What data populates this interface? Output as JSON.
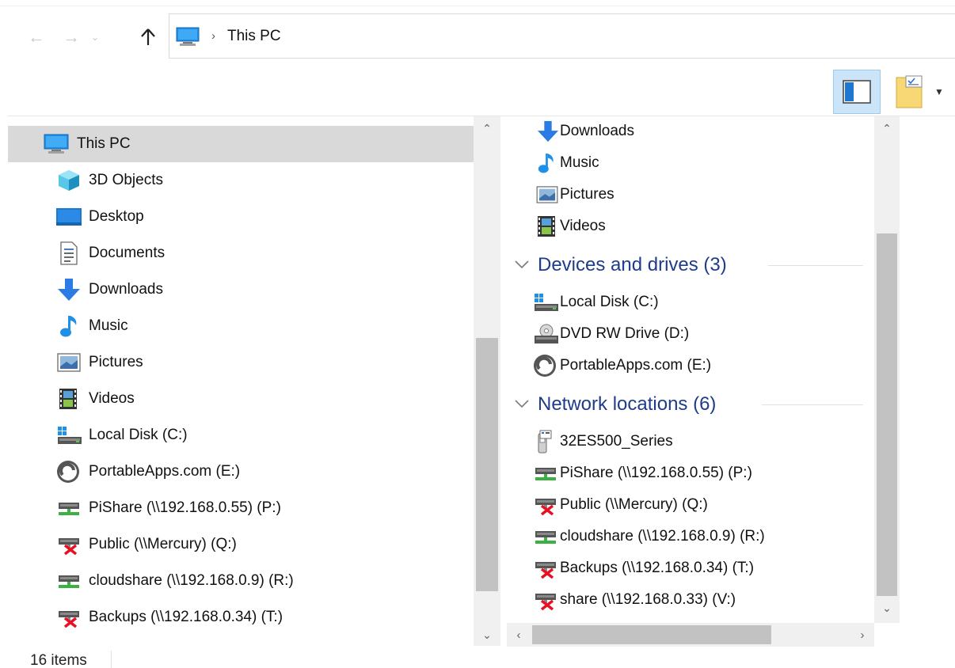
{
  "address_bar": {
    "location_icon": "this-pc-icon",
    "crumbs": [
      "This PC"
    ]
  },
  "nav_tree": {
    "items": [
      {
        "label": "This PC",
        "icon": "this-pc-icon",
        "selected": true
      },
      {
        "label": "3D Objects",
        "icon": "3d-objects-icon"
      },
      {
        "label": "Desktop",
        "icon": "desktop-icon"
      },
      {
        "label": "Documents",
        "icon": "documents-icon"
      },
      {
        "label": "Downloads",
        "icon": "downloads-icon"
      },
      {
        "label": "Music",
        "icon": "music-icon"
      },
      {
        "label": "Pictures",
        "icon": "pictures-icon"
      },
      {
        "label": "Videos",
        "icon": "videos-icon"
      },
      {
        "label": "Local Disk (C:)",
        "icon": "local-disk-icon"
      },
      {
        "label": "PortableApps.com (E:)",
        "icon": "portableapps-drive-icon"
      },
      {
        "label": "PiShare (\\\\192.168.0.55) (P:)",
        "icon": "network-drive-connected-icon"
      },
      {
        "label": "Public (\\\\Mercury) (Q:)",
        "icon": "network-drive-disconnected-icon"
      },
      {
        "label": "cloudshare (\\\\192.168.0.9) (R:)",
        "icon": "network-drive-connected-icon"
      },
      {
        "label": "Backups (\\\\192.168.0.34) (T:)",
        "icon": "network-drive-disconnected-icon"
      }
    ]
  },
  "content": {
    "folders": [
      {
        "label": "Downloads",
        "icon": "downloads-icon"
      },
      {
        "label": "Music",
        "icon": "music-icon"
      },
      {
        "label": "Pictures",
        "icon": "pictures-icon"
      },
      {
        "label": "Videos",
        "icon": "videos-icon"
      }
    ],
    "devices_group": {
      "title": "Devices and drives (3)"
    },
    "devices": [
      {
        "label": "Local Disk (C:)",
        "icon": "local-disk-icon"
      },
      {
        "label": "DVD RW Drive (D:)",
        "icon": "dvd-drive-icon"
      },
      {
        "label": "PortableApps.com (E:)",
        "icon": "portableapps-drive-icon"
      }
    ],
    "network_group": {
      "title": "Network locations (6)"
    },
    "network": [
      {
        "label": "32ES500_Series",
        "icon": "media-device-icon"
      },
      {
        "label": "PiShare (\\\\192.168.0.55) (P:)",
        "icon": "network-drive-connected-icon"
      },
      {
        "label": "Public (\\\\Mercury) (Q:)",
        "icon": "network-drive-disconnected-icon"
      },
      {
        "label": "cloudshare (\\\\192.168.0.9) (R:)",
        "icon": "network-drive-connected-icon"
      },
      {
        "label": "Backups (\\\\192.168.0.34) (T:)",
        "icon": "network-drive-disconnected-icon"
      },
      {
        "label": "share (\\\\192.168.0.33) (V:)",
        "icon": "network-drive-disconnected-icon"
      }
    ]
  },
  "status": {
    "item_count": "16 items"
  },
  "colors": {
    "selection": "#d9d9d9",
    "group_header": "#1e3c8c",
    "pane_toggle_active": "#cce4f7",
    "scrollbar_track": "#f0f0f0",
    "scrollbar_thumb": "#c2c2c2"
  }
}
